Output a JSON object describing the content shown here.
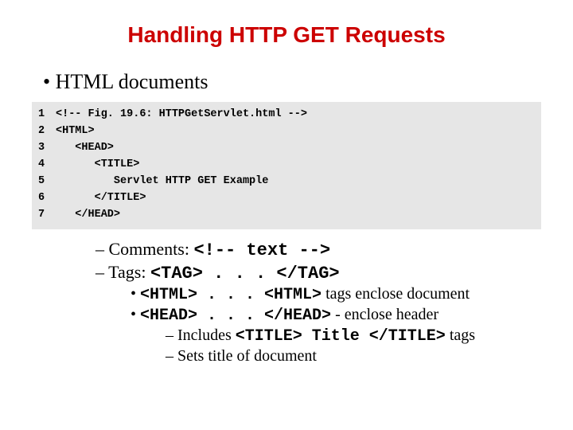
{
  "title": "Handling HTTP GET Requests",
  "bullet_main": "HTML documents",
  "code": {
    "ln1": "1",
    "c1": "<!-- Fig. 19.6: HTTPGetServlet.html -->",
    "ln2": "2",
    "c2": "<HTML>",
    "ln3": "3",
    "c3": "   <HEAD>",
    "ln4": "4",
    "c4": "      <TITLE>",
    "ln5": "5",
    "c5": "         Servlet HTTP GET Example",
    "ln6": "6",
    "c6": "      </TITLE>",
    "ln7": "7",
    "c7": "   </HEAD>"
  },
  "notes": {
    "n1a": "Comments: ",
    "n1b": "<!-- text -->",
    "n2a": "Tags: ",
    "n2b": "<TAG> . . . </TAG>",
    "n3a": "<HTML> . . . <HTML>",
    "n3b": " tags enclose document",
    "n4a": "<HEAD> . . . </HEAD>",
    "n4b": " - enclose header",
    "n5a": "Includes ",
    "n5b": "<TITLE> Title </TITLE>",
    "n5c": " tags",
    "n6": "Sets title of document"
  }
}
